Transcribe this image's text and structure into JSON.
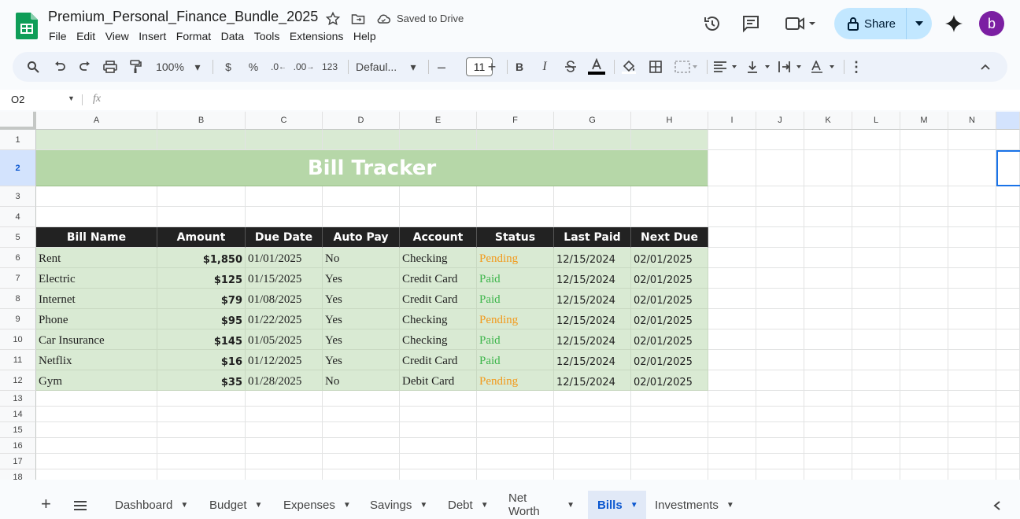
{
  "doc": {
    "title": "Premium_Personal_Finance_Bundle_2025",
    "saved_status": "Saved to Drive"
  },
  "menu": [
    "File",
    "Edit",
    "View",
    "Insert",
    "Format",
    "Data",
    "Tools",
    "Extensions",
    "Help"
  ],
  "header": {
    "share_label": "Share",
    "avatar_letter": "b"
  },
  "toolbar": {
    "zoom": "100%",
    "currency": "$",
    "percent": "%",
    "dec_decrease": ".0",
    "dec_increase": ".00",
    "format_123": "123",
    "font": "Defaul...",
    "font_size": "11",
    "bold": "B",
    "italic": "I"
  },
  "formula_bar": {
    "name_box": "O2",
    "fx": "fx",
    "content": ""
  },
  "columns": [
    "A",
    "B",
    "C",
    "D",
    "E",
    "F",
    "G",
    "H",
    "I",
    "J",
    "K",
    "L",
    "M",
    "N"
  ],
  "rows": [
    "1",
    "2",
    "3",
    "4",
    "5",
    "6",
    "7",
    "8",
    "9",
    "10",
    "11",
    "12",
    "13",
    "14",
    "15",
    "16",
    "17",
    "18"
  ],
  "sheet": {
    "title": "Bill Tracker",
    "headers": [
      "Bill Name",
      "Amount",
      "Due Date",
      "Auto Pay",
      "Account",
      "Status",
      "Last Paid",
      "Next Due"
    ],
    "data": [
      [
        "Rent",
        "$1,850",
        "01/01/2025",
        "No",
        "Checking",
        "Pending",
        "12/15/2024",
        "02/01/2025"
      ],
      [
        "Electric",
        "$125",
        "01/15/2025",
        "Yes",
        "Credit Card",
        "Paid",
        "12/15/2024",
        "02/01/2025"
      ],
      [
        "Internet",
        "$79",
        "01/08/2025",
        "Yes",
        "Credit Card",
        "Paid",
        "12/15/2024",
        "02/01/2025"
      ],
      [
        "Phone",
        "$95",
        "01/22/2025",
        "Yes",
        "Checking",
        "Pending",
        "12/15/2024",
        "02/01/2025"
      ],
      [
        "Car Insurance",
        "$145",
        "01/05/2025",
        "Yes",
        "Checking",
        "Paid",
        "12/15/2024",
        "02/01/2025"
      ],
      [
        "Netflix",
        "$16",
        "01/12/2025",
        "Yes",
        "Credit Card",
        "Paid",
        "12/15/2024",
        "02/01/2025"
      ],
      [
        "Gym",
        "$35",
        "01/28/2025",
        "No",
        "Debit Card",
        "Pending",
        "12/15/2024",
        "02/01/2025"
      ]
    ]
  },
  "tabs": [
    {
      "label": "Dashboard",
      "active": false
    },
    {
      "label": "Budget",
      "active": false
    },
    {
      "label": "Expenses",
      "active": false
    },
    {
      "label": "Savings",
      "active": false
    },
    {
      "label": "Debt",
      "active": false
    },
    {
      "label": "Net Worth",
      "active": false
    },
    {
      "label": "Bills",
      "active": true
    },
    {
      "label": "Investments",
      "active": false
    }
  ],
  "colors": {
    "title_band": "#b6d7a8",
    "data_fill": "#d9ead3",
    "header_fill": "#222222",
    "pending": "#f29a1c",
    "paid": "#3cb54a",
    "share_bg": "#c2e7ff",
    "avatar_bg": "#7b1fa2"
  }
}
